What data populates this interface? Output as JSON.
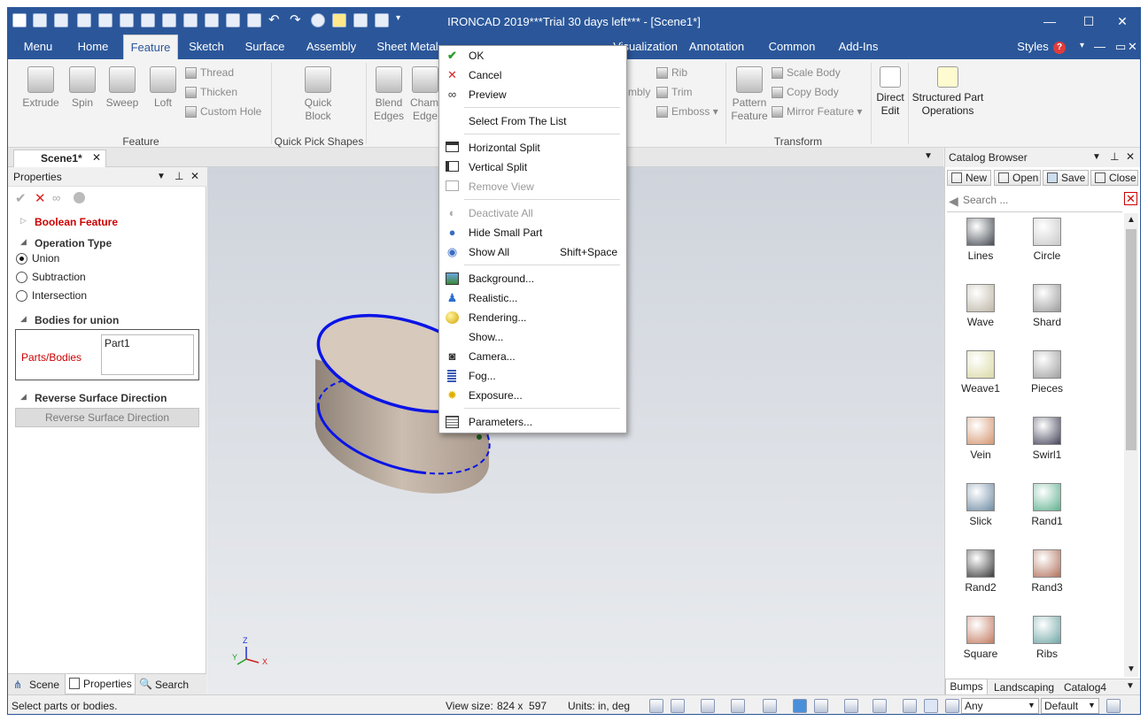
{
  "window": {
    "title": "IRONCAD 2019***Trial 30 days left*** - [Scene1*]"
  },
  "menubar": {
    "tabs": [
      "Menu",
      "Home",
      "Feature",
      "Sketch",
      "Surface",
      "Assembly",
      "Sheet Metal",
      "Visualization",
      "Annotation",
      "Common",
      "Add-Ins"
    ],
    "styles": "Styles"
  },
  "ribbon": {
    "extrude": "Extrude",
    "spin": "Spin",
    "sweep": "Sweep",
    "loft": "Loft",
    "thread": "Thread",
    "thicken": "Thicken",
    "custom_hole": "Custom Hole",
    "feature_group": "Feature",
    "quick_block": "Quick\nBlock",
    "quick_pick_group": "Quick Pick Shapes",
    "blend_edges": "Blend\nEdges",
    "chamfer_edges": "Chamf\nEdge",
    "assembly": "mbly",
    "rib": "Rib",
    "trim": "Trim",
    "emboss": "Emboss",
    "pattern_feature": "Pattern\nFeature",
    "scale_body": "Scale Body",
    "copy_body": "Copy Body",
    "mirror_feature": "Mirror Feature",
    "transform_group": "Transform",
    "direct_edit": "Direct\nEdit",
    "structured_part": "Structured Part\nOperations"
  },
  "doc_tab": {
    "label": "Scene1*"
  },
  "properties": {
    "title": "Properties",
    "boolean_feature": "Boolean Feature",
    "operation_type": "Operation Type",
    "options": [
      "Union",
      "Subtraction",
      "Intersection"
    ],
    "selected_option": "Union",
    "bodies_header": "Bodies for union",
    "parts_label": "Parts/Bodies",
    "parts_value": "Part1",
    "reverse_header": "Reverse Surface Direction",
    "reverse_button": "Reverse Surface Direction",
    "bottom_tabs": [
      "Scene",
      "Properties",
      "Search"
    ]
  },
  "context_menu": {
    "items": [
      {
        "label": "OK",
        "icon": "check-icon",
        "enabled": true
      },
      {
        "label": "Cancel",
        "icon": "x-icon",
        "enabled": true
      },
      {
        "label": "Preview",
        "icon": "glasses-icon",
        "enabled": true
      },
      {
        "label": "Select From The List",
        "icon": "",
        "enabled": true
      },
      {
        "label": "Horizontal Split",
        "icon": "hsplit-icon",
        "enabled": true
      },
      {
        "label": "Vertical Split",
        "icon": "vsplit-icon",
        "enabled": true
      },
      {
        "label": "Remove View",
        "icon": "remove-view-icon",
        "enabled": false
      },
      {
        "label": "Deactivate All",
        "icon": "deactivate-icon",
        "enabled": false
      },
      {
        "label": "Hide Small Part",
        "icon": "hide-part-icon",
        "enabled": true
      },
      {
        "label": "Show All",
        "icon": "show-all-icon",
        "enabled": true,
        "shortcut": "Shift+Space"
      },
      {
        "label": "Background...",
        "icon": "background-icon",
        "enabled": true
      },
      {
        "label": "Realistic...",
        "icon": "realistic-icon",
        "enabled": true
      },
      {
        "label": "Rendering...",
        "icon": "rendering-icon",
        "enabled": true
      },
      {
        "label": "Show...",
        "icon": "",
        "enabled": true
      },
      {
        "label": "Camera...",
        "icon": "camera-icon",
        "enabled": true
      },
      {
        "label": "Fog...",
        "icon": "fog-icon",
        "enabled": true
      },
      {
        "label": "Exposure...",
        "icon": "exposure-icon",
        "enabled": true
      },
      {
        "label": "Parameters...",
        "icon": "parameters-icon",
        "enabled": true
      }
    ]
  },
  "catalog": {
    "title": "Catalog Browser",
    "buttons": [
      "New",
      "Open",
      "Save",
      "Close"
    ],
    "search_placeholder": "Search ...",
    "items": [
      "Lines",
      "Circle",
      "Wave",
      "Shard",
      "Weave1",
      "Pieces",
      "Vein",
      "Swirl1",
      "Slick",
      "Rand1",
      "Rand2",
      "Rand3",
      "Square",
      "Ribs"
    ],
    "thumb_colors": [
      "#444a52",
      "#c8c8c8",
      "#bdb5a5",
      "#9a9a9a",
      "#d9d9a5",
      "#9e9e9e",
      "#d4946e",
      "#43435a",
      "#6d8aa3",
      "#5fb08f",
      "#3a3a3a",
      "#b0705a",
      "#c27a60",
      "#6fa5a5"
    ],
    "tabs": [
      "Bumps",
      "Landscaping",
      "Catalog4"
    ]
  },
  "status": {
    "message": "Select parts or bodies.",
    "view_size_label": "View size:",
    "view_size": "824 x  597",
    "units": "Units: in, deg",
    "filter": "Any",
    "mode": "Default"
  },
  "axis": {
    "z": "Z",
    "y": "Y",
    "x": "X"
  }
}
